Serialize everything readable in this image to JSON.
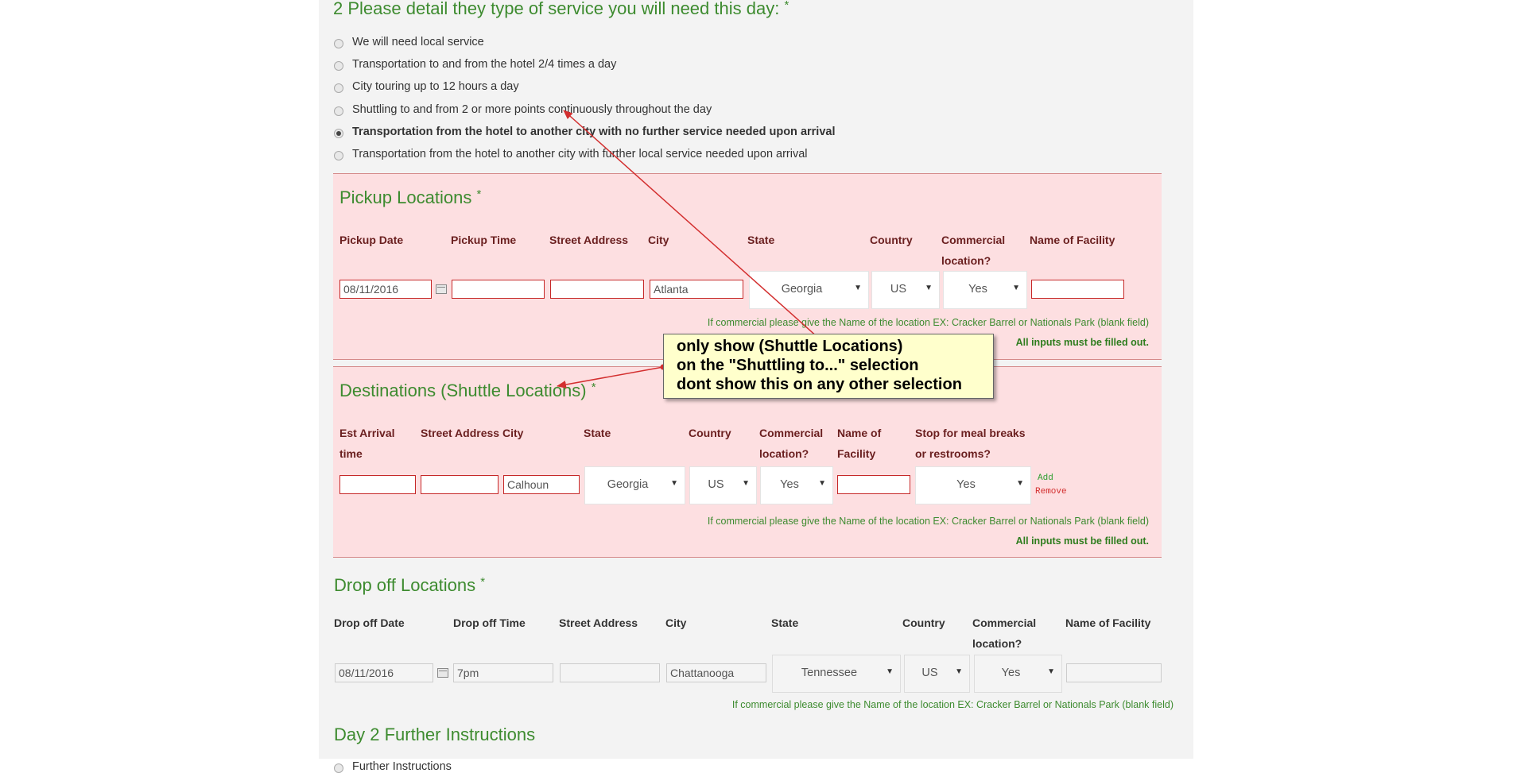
{
  "question": {
    "title": "2 Please detail they type of service you will need this day:",
    "required": "*"
  },
  "options": [
    {
      "label": "We will need local service",
      "selected": false
    },
    {
      "label": "Transportation to and from the hotel 2/4 times a day",
      "selected": false
    },
    {
      "label": "City touring up to 12 hours a day",
      "selected": false
    },
    {
      "label": "Shuttling to and from 2 or more points continuously throughout the day",
      "selected": false
    },
    {
      "label": "Transportation from the hotel to another city with no further service needed upon arrival",
      "selected": true
    },
    {
      "label": "Transportation from the hotel to another city with further local service needed upon arrival",
      "selected": false
    }
  ],
  "pickup": {
    "title": "Pickup Locations",
    "required": "*",
    "headers": {
      "date": "Pickup Date",
      "time": "Pickup Time",
      "street": "Street Address",
      "city": "City",
      "state": "State",
      "country": "Country",
      "commercial": "Commercial location?",
      "facility": "Name of Facility"
    },
    "values": {
      "date": "08/11/2016",
      "time": "",
      "street": "",
      "city": "Atlanta",
      "state": "Georgia",
      "country": "US",
      "commercial": "Yes",
      "facility": ""
    },
    "hint": "If commercial please give the Name of the location EX: Cracker Barrel or Nationals Park (blank field)",
    "must": "All inputs must be filled out."
  },
  "destinations": {
    "title": "Destinations (Shuttle Locations)",
    "required": "*",
    "headers": {
      "arrival": "Est Arrival time",
      "street": "Street Address",
      "city": "City",
      "state": "State",
      "country": "Country",
      "commercial": "Commercial location?",
      "facility": "Name of Facility",
      "stop": "Stop for meal breaks or restrooms?"
    },
    "values": {
      "arrival": "",
      "street": "",
      "city": "Calhoun",
      "state": "Georgia",
      "country": "US",
      "commercial": "Yes",
      "facility": "",
      "stop": "Yes"
    },
    "add_label": "Add",
    "remove_label": "Remove",
    "hint": "If commercial please give the Name of the location EX: Cracker Barrel or Nationals Park (blank field)",
    "must": "All inputs must be filled out."
  },
  "dropoff": {
    "title": "Drop off Locations",
    "required": "*",
    "headers": {
      "date": "Drop off Date",
      "time": "Drop off Time",
      "street": "Street Address",
      "city": "City",
      "state": "State",
      "country": "Country",
      "commercial": "Commercial location?",
      "facility": "Name of Facility"
    },
    "values": {
      "date": "08/11/2016",
      "time": "7pm",
      "street": "",
      "city": "Chattanooga",
      "state": "Tennessee",
      "country": "US",
      "commercial": "Yes",
      "facility": ""
    },
    "hint": "If commercial please give the Name of the location EX: Cracker Barrel or Nationals Park (blank field)"
  },
  "day2": {
    "title": "Day 2 Further Instructions",
    "option_label": "Further Instructions"
  },
  "annotation": {
    "lines": [
      "only show (Shuttle Locations)",
      "on the \"Shuttling to...\" selection",
      "dont show this on any other selection"
    ]
  },
  "colors": {
    "green": "#3d8b2f",
    "panel_pink": "#fddfe1",
    "label_maroon": "#6a1f1f",
    "arrow_red": "#d32f2f"
  }
}
